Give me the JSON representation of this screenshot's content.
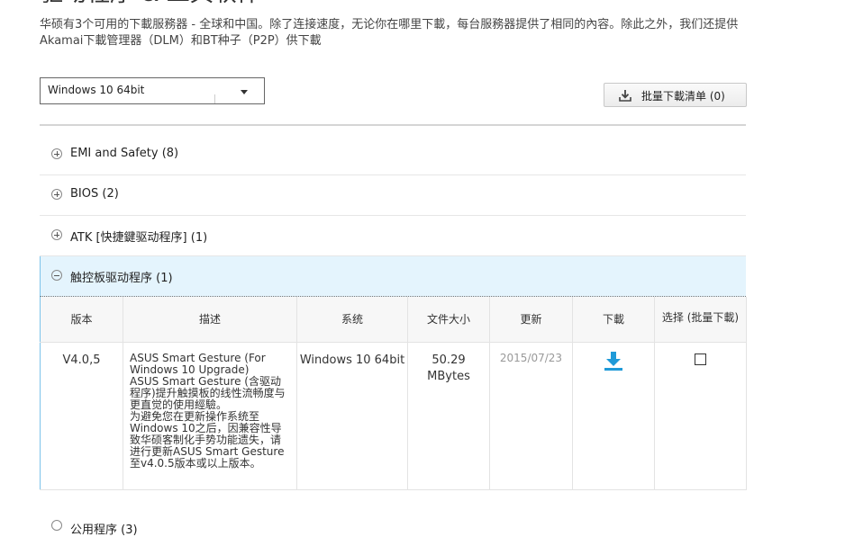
{
  "page": {
    "title": "驱动程序 & 工具软件",
    "intro": "华硕有3个可用的下載服務器 - 全球和中国。除了连接速度，无论你在哪里下載，每台服務器提供了相同的內容。除此之外，我们还提供Akamai下載管理器（DLM）和BT种子（P2P）供下載"
  },
  "os_select": {
    "value": "Windows 10 64bit"
  },
  "batch_button": {
    "label": "批量下載清单 (0)",
    "icon": "download-tray-icon"
  },
  "categories": [
    {
      "label": "EMI and Safety  (8)",
      "expanded": false
    },
    {
      "label": "BIOS (2)",
      "expanded": false
    },
    {
      "label": "ATK [快捷鍵驱动程序] (1)",
      "expanded": false
    },
    {
      "label": "触控板驱动程序  (1)",
      "expanded": true
    }
  ],
  "table": {
    "headers": {
      "version": "版本",
      "description": "描述",
      "os": "系统",
      "size": "文件大小",
      "updated": "更新",
      "download": "下載",
      "select": "选择 (批量下載)"
    },
    "rows": [
      {
        "version": "V4.0,5",
        "description": "ASUS Smart Gesture (For Windows 10 Upgrade)\nASUS Smart Gesture (含驱动程序)提升触摸板的线性流畅度与更直觉的使用經驗。\n为避免您在更新操作系统至Windows 10之后，因兼容性导致华硕客制化手势功能遗失，请进行更新ASUS Smart Gesture至v4.0.5版本或以上版本。",
        "os": "Windows 10 64bit",
        "size": "50.29 MBytes",
        "updated": "2015/07/23",
        "download_icon": "download-arrow-icon",
        "selected": false
      }
    ]
  },
  "partial_category": {
    "label": "公用程序 (3)"
  },
  "colors": {
    "active_bg": "#e4f4fd",
    "active_border": "#7cc3ea",
    "download_blue": "#1f9ad8",
    "date_gray": "#999999"
  }
}
